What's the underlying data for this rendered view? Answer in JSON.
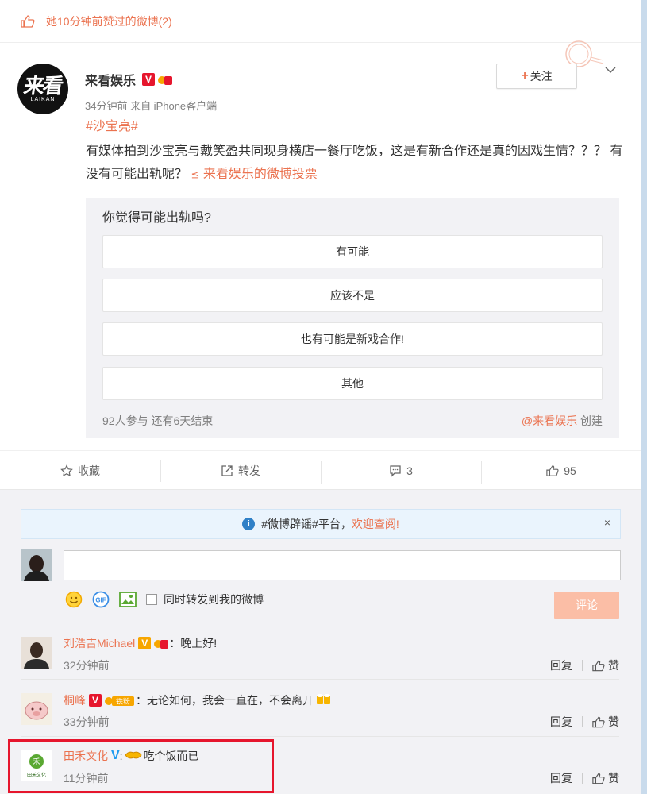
{
  "top_notice": {
    "text": "她10分钟前赞过的微博(2)"
  },
  "post": {
    "author": {
      "name": "来看娱乐",
      "avatar_text": "来看",
      "avatar_sub": "LAIKAN",
      "badge": "V"
    },
    "meta": "34分钟前 来自 iPhone客户端",
    "follow_label": "关注",
    "hashtag": "#沙宝亮#",
    "text": "有媒体拍到沙宝亮与戴笑盈共同现身横店一餐厅吃饭，这是有新合作还是真的因戏生情？？？ 有没有可能出轨呢？",
    "vote_link": "来看娱乐的微博投票",
    "poll": {
      "question": "你觉得可能出轨吗?",
      "options": [
        "有可能",
        "应该不是",
        "也有可能是新戏合作!",
        "其他"
      ],
      "participants": "92人参与 还有6天结束",
      "creator_at": "@来看娱乐",
      "creator_suffix": "创建"
    }
  },
  "actions": {
    "favorite": "收藏",
    "repost": "转发",
    "comments": "3",
    "likes": "95"
  },
  "comments_section": {
    "notice_prefix": "#微博辟谣#平台，",
    "notice_link": "欢迎查阅!",
    "close": "×",
    "repost_checkbox": "同时转发到我的微博",
    "submit": "评论",
    "items": [
      {
        "name": "刘浩吉Michael",
        "text": "：晚上好!",
        "time": "32分钟前",
        "reply": "回复",
        "like": "赞"
      },
      {
        "name": "桐峰",
        "text": "：无论如何，我会一直在，不会离开",
        "time": "33分钟前",
        "reply": "回复",
        "like": "赞",
        "tag": "铁粉"
      },
      {
        "name": "田禾文化",
        "text": "：吃个饭而已",
        "time": "11分钟前",
        "reply": "回复",
        "like": "赞",
        "avatar_text": "田禾文化"
      }
    ]
  },
  "colors": {
    "accent": "#eb7350",
    "verified_gold": "#f7a600",
    "verified_red": "#e6162d",
    "verified_blue": "#1d9bf0"
  }
}
